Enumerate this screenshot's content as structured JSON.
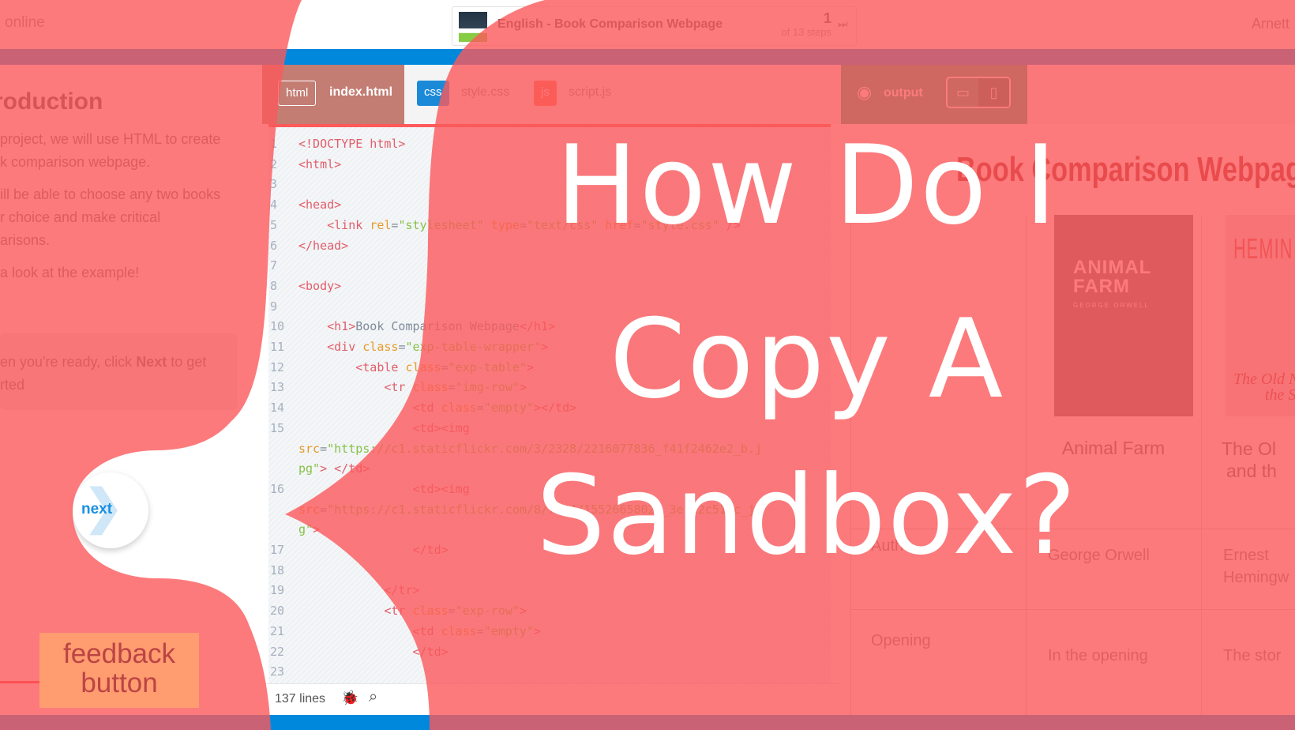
{
  "topbar": {
    "status": "online",
    "project_title": "English - Book Comparison Webpage",
    "step_number": "1",
    "step_total": "of 13 steps",
    "skip_icon": "skip-forward-icon",
    "skip_glyph": "⏭",
    "user": "Arnett"
  },
  "instructions": {
    "heading": "roduction",
    "paragraphs": [
      "project, we will use HTML to create",
      "k comparison webpage.",
      "ill be able to choose any two books",
      "r choice and make critical",
      "arisons.",
      "a look at the example!"
    ],
    "callout_prefix": "en you're ready, click ",
    "callout_bold": "Next",
    "callout_suffix": " to get",
    "callout_line2": "rted",
    "next_label": "next",
    "next_glyph": "❯",
    "feedback_line1": "feedback",
    "feedback_line2": "button"
  },
  "editor": {
    "tabs": [
      {
        "badge": "html",
        "label": "index.html",
        "active": true
      },
      {
        "badge": "css",
        "label": "style.css",
        "active": false,
        "badge_color": "#1a8ad8"
      },
      {
        "badge": "js",
        "label": "script.js",
        "active": false,
        "badge_color": "#ff6a4a"
      }
    ],
    "code": [
      {
        "n": "1",
        "tokens": [
          [
            "tag",
            "<!DOCTYPE html>"
          ]
        ]
      },
      {
        "n": "2",
        "tokens": [
          [
            "tag",
            "<html>"
          ]
        ]
      },
      {
        "n": "3",
        "tokens": []
      },
      {
        "n": "4",
        "tokens": [
          [
            "tag",
            "<head>"
          ]
        ]
      },
      {
        "n": "5",
        "tokens": [
          [
            "txt",
            "    "
          ],
          [
            "tag",
            "<link "
          ],
          [
            "attr",
            "rel"
          ],
          [
            "txt",
            "="
          ],
          [
            "str",
            "\"stylesheet\""
          ],
          [
            "attr",
            " type"
          ],
          [
            "txt",
            "="
          ],
          [
            "str",
            "\"text/css\""
          ],
          [
            "attr",
            " href"
          ],
          [
            "txt",
            "="
          ],
          [
            "str",
            "\"style.css\""
          ],
          [
            "tag",
            " />"
          ]
        ]
      },
      {
        "n": "6",
        "tokens": [
          [
            "tag",
            "</head>"
          ]
        ]
      },
      {
        "n": "7",
        "tokens": []
      },
      {
        "n": "8",
        "tokens": [
          [
            "tag",
            "<body>"
          ]
        ]
      },
      {
        "n": "9",
        "tokens": []
      },
      {
        "n": "10",
        "tokens": [
          [
            "txt",
            "    "
          ],
          [
            "tag",
            "<h1>"
          ],
          [
            "txt",
            "Book Comparison Webpage"
          ],
          [
            "tag",
            "</h1>"
          ]
        ]
      },
      {
        "n": "11",
        "tokens": [
          [
            "txt",
            "    "
          ],
          [
            "tag",
            "<div "
          ],
          [
            "attr",
            "class"
          ],
          [
            "txt",
            "="
          ],
          [
            "str",
            "\"exp-table-wrapper\""
          ],
          [
            "tag",
            ">"
          ]
        ]
      },
      {
        "n": "12",
        "tokens": [
          [
            "txt",
            "        "
          ],
          [
            "tag",
            "<table "
          ],
          [
            "attr",
            "class"
          ],
          [
            "txt",
            "="
          ],
          [
            "str",
            "\"exp-table\""
          ],
          [
            "tag",
            ">"
          ]
        ]
      },
      {
        "n": "13",
        "tokens": [
          [
            "txt",
            "            "
          ],
          [
            "tag",
            "<tr "
          ],
          [
            "attr",
            "class"
          ],
          [
            "txt",
            "="
          ],
          [
            "str",
            "\"img-row\""
          ],
          [
            "tag",
            ">"
          ]
        ]
      },
      {
        "n": "14",
        "tokens": [
          [
            "txt",
            "                "
          ],
          [
            "tag",
            "<td "
          ],
          [
            "attr",
            "class"
          ],
          [
            "txt",
            "="
          ],
          [
            "str",
            "\"empty\""
          ],
          [
            "tag",
            "></td>"
          ]
        ]
      },
      {
        "n": "15",
        "tokens": [
          [
            "txt",
            "                "
          ],
          [
            "tag",
            "<td><img"
          ]
        ]
      },
      {
        "n": "",
        "tokens": [
          [
            "attr",
            "src"
          ],
          [
            "txt",
            "="
          ],
          [
            "str",
            "\"https://c1.staticflickr.com/3/2328/2216077836_f41f2462e2_b.j"
          ]
        ]
      },
      {
        "n": "",
        "tokens": [
          [
            "str",
            "pg\""
          ],
          [
            "tag",
            "> </td>"
          ]
        ]
      },
      {
        "n": "16",
        "tokens": [
          [
            "txt",
            "                "
          ],
          [
            "tag",
            "<td><img"
          ]
        ]
      },
      {
        "n": "",
        "tokens": [
          [
            "attr",
            "src"
          ],
          [
            "txt",
            "="
          ],
          [
            "str",
            "\"https://c1.staticflickr.com/8/7544/15526658024_3e1d2c51fc_j"
          ]
        ]
      },
      {
        "n": "",
        "tokens": [
          [
            "str",
            "g\""
          ],
          [
            "tag",
            ">"
          ]
        ]
      },
      {
        "n": "17",
        "tokens": [
          [
            "txt",
            "                "
          ],
          [
            "tag",
            "</td>"
          ]
        ]
      },
      {
        "n": "18",
        "tokens": []
      },
      {
        "n": "19",
        "tokens": [
          [
            "txt",
            "            "
          ],
          [
            "tag",
            "</tr>"
          ]
        ]
      },
      {
        "n": "20",
        "tokens": [
          [
            "txt",
            "            "
          ],
          [
            "tag",
            "<tr "
          ],
          [
            "attr",
            "class"
          ],
          [
            "txt",
            "="
          ],
          [
            "str",
            "\"exp-row\""
          ],
          [
            "tag",
            ">"
          ]
        ]
      },
      {
        "n": "21",
        "tokens": [
          [
            "txt",
            "                "
          ],
          [
            "tag",
            "<td "
          ],
          [
            "attr",
            "class"
          ],
          [
            "txt",
            "="
          ],
          [
            "str",
            "\"empty\""
          ],
          [
            "tag",
            ">"
          ]
        ]
      },
      {
        "n": "22",
        "tokens": [
          [
            "txt",
            "                "
          ],
          [
            "tag",
            "</td>"
          ]
        ]
      },
      {
        "n": "23",
        "tokens": []
      }
    ],
    "footer_lines": "137 lines",
    "bug_glyph": "🐞",
    "search_glyph": "⌕"
  },
  "output": {
    "label": "output",
    "eye_glyph": "◉",
    "desktop_glyph": "▭",
    "mobile_glyph": "▯",
    "page_title": "Book Comparison Webpage",
    "cover1_title_l1": "ANIMAL",
    "cover1_title_l2": "FARM",
    "cover1_author": "GEORGE ORWELL",
    "cover2_author": "HEMIN",
    "cover2_title_l1": "The Old N",
    "cover2_title_l2": "the S",
    "book1": "Animal Farm",
    "book2_l1": "The Ol",
    "book2_l2": "and th",
    "row_author": "Autho",
    "author1": "George Orwell",
    "author2_l1": "Ernest",
    "author2_l2": "Hemingw",
    "row_opening": "Opening",
    "opening1": "In the opening",
    "opening2": "The stor"
  },
  "overlay": {
    "color": "#fb595b",
    "title_lines": [
      "How Do I",
      "Copy A",
      "Sandbox?"
    ]
  }
}
